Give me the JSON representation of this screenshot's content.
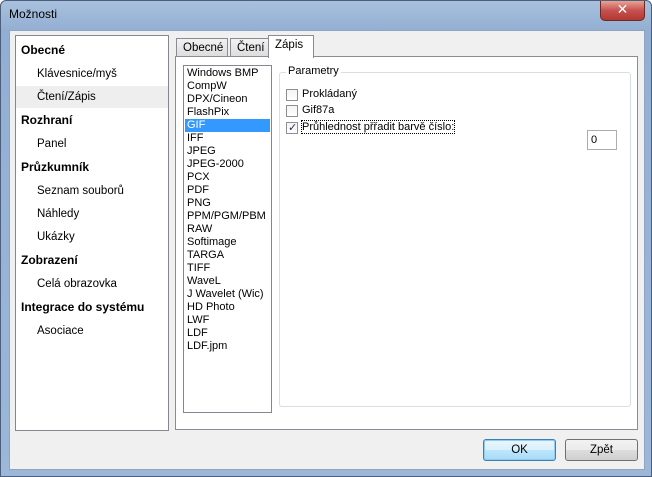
{
  "window": {
    "title": "Možnosti",
    "close_symbol": "✕"
  },
  "nav": {
    "items": [
      {
        "type": "category",
        "label": "Obecné"
      },
      {
        "type": "item",
        "label": "Klávesnice/myš"
      },
      {
        "type": "item",
        "label": "Čtení/Zápis",
        "selected": true
      },
      {
        "type": "category",
        "label": "Rozhraní"
      },
      {
        "type": "item",
        "label": "Panel"
      },
      {
        "type": "category",
        "label": "Průzkumník"
      },
      {
        "type": "item",
        "label": "Seznam souborů"
      },
      {
        "type": "item",
        "label": "Náhledy"
      },
      {
        "type": "item",
        "label": "Ukázky"
      },
      {
        "type": "category",
        "label": "Zobrazení"
      },
      {
        "type": "item",
        "label": "Celá obrazovka"
      },
      {
        "type": "category",
        "label": "Integrace do systému"
      },
      {
        "type": "item",
        "label": "Asociace"
      }
    ]
  },
  "tabs": [
    {
      "label": "Obecné"
    },
    {
      "label": "Čtení"
    },
    {
      "label": "Zápis",
      "active": true
    }
  ],
  "formats": {
    "selected": "GIF",
    "items": [
      "Windows BMP",
      "CompW",
      "DPX/Cineon",
      "FlashPix",
      "GIF",
      "IFF",
      "JPEG",
      "JPEG-2000",
      "PCX",
      "PDF",
      "PNG",
      "PPM/PGM/PBM",
      "RAW",
      "Softimage",
      "TARGA",
      "TIFF",
      "WaveL",
      "J Wavelet (Wic)",
      "HD Photo",
      "LWF",
      "LDF",
      "LDF.jpm"
    ]
  },
  "params": {
    "legend": "Parametry",
    "interlaced": {
      "label": "Prokládaný",
      "checked": false
    },
    "gif87a": {
      "label": "Gif87a",
      "checked": false
    },
    "transparency": {
      "label": "Průhlednost přřadit barvě číslo:",
      "checked": true
    },
    "color_number": "0",
    "check_symbol": "✓"
  },
  "buttons": {
    "ok": "OK",
    "back": "Zpět"
  }
}
